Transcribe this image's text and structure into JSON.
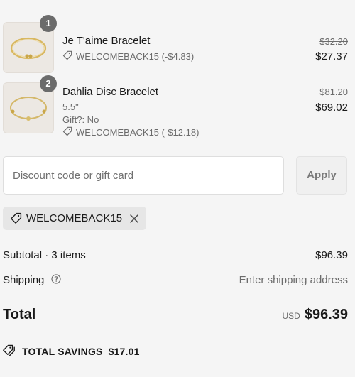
{
  "line_items": [
    {
      "quantity": "1",
      "name": "Je T'aime Bracelet",
      "discount": "WELCOMEBACK15 (-$4.83)",
      "original_price": "$32.20",
      "price": "$27.37"
    },
    {
      "quantity": "2",
      "name": "Dahlia Disc Bracelet",
      "size": "5.5\"",
      "gift": "Gift?: No",
      "discount": "WELCOMEBACK15 (-$12.18)",
      "original_price": "$81.20",
      "price": "$69.02"
    }
  ],
  "discount_form": {
    "placeholder": "Discount code or gift card",
    "value": "",
    "apply_label": "Apply"
  },
  "applied_code": "WELCOMEBACK15",
  "summary": {
    "subtotal_label": "Subtotal · 3 items",
    "subtotal_value": "$96.39",
    "shipping_label": "Shipping",
    "shipping_value": "Enter shipping address",
    "total_label": "Total",
    "currency": "USD",
    "total_value": "$96.39",
    "savings_label": "TOTAL SAVINGS",
    "savings_value": "$17.01"
  },
  "icons": [
    "tag-icon",
    "close-icon",
    "help-circle-icon",
    "savings-tag-icon"
  ],
  "colors": {
    "text": "#1a1a1a",
    "muted": "#6b6b6b",
    "badge": "#6b6b6b",
    "background": "#f5f5f5"
  }
}
